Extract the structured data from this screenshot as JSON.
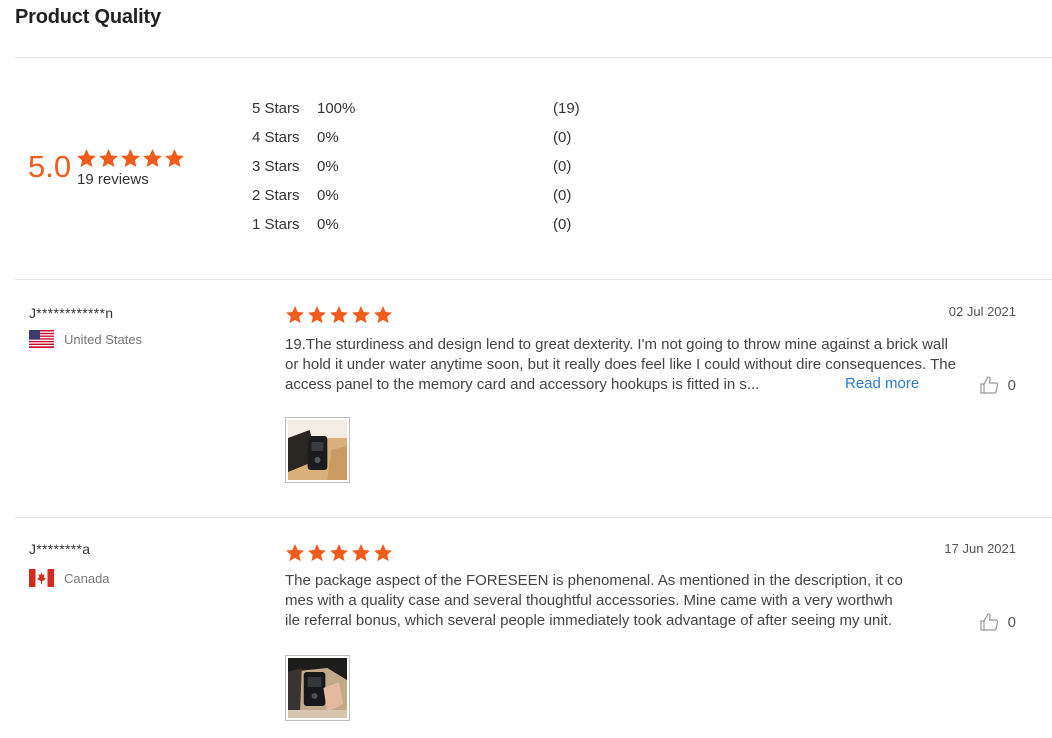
{
  "section_title": "Product Quality",
  "summary": {
    "average": "5.0",
    "star_rating": 5,
    "review_count": "19 reviews",
    "distribution": [
      {
        "label": "5 Stars",
        "percent": "100%",
        "count": "(19)"
      },
      {
        "label": "4 Stars",
        "percent": "0%",
        "count": "(0)"
      },
      {
        "label": "3 Stars",
        "percent": "0%",
        "count": "(0)"
      },
      {
        "label": "2 Stars",
        "percent": "0%",
        "count": "(0)"
      },
      {
        "label": "1 Stars",
        "percent": "0%",
        "count": "(0)"
      }
    ]
  },
  "colors": {
    "star": "#f05c1c",
    "link": "#2e7cc9"
  },
  "icons": {
    "star": "star-icon",
    "like": "thumbs-up-icon"
  },
  "reviews": [
    {
      "reviewer": "J************n",
      "country": "United States",
      "flag": "us-flag-icon",
      "rating": 5,
      "date": "02 Jul 2021",
      "text_lines": [
        "19.The sturdiness and design lend to great dexterity. I'm not going to throw mine against a brick wall",
        "or hold it under water anytime soon, but it really does feel like I could without dire consequences. The",
        "access panel to the memory card and accessory hookups is fitted in s..."
      ],
      "read_more": "Read more",
      "likes": "0"
    },
    {
      "reviewer": "J********a",
      "country": "Canada",
      "flag": "canada-flag-icon",
      "rating": 5,
      "date": "17 Jun 2021",
      "text_lines": [
        "The package aspect of the FORESEEN is phenomenal. As mentioned in the description, it co",
        "mes with a quality case and several thoughtful accessories. Mine came with a very worthwh",
        "ile referral bonus, which several people immediately took advantage of after seeing my unit."
      ],
      "likes": "0"
    }
  ]
}
